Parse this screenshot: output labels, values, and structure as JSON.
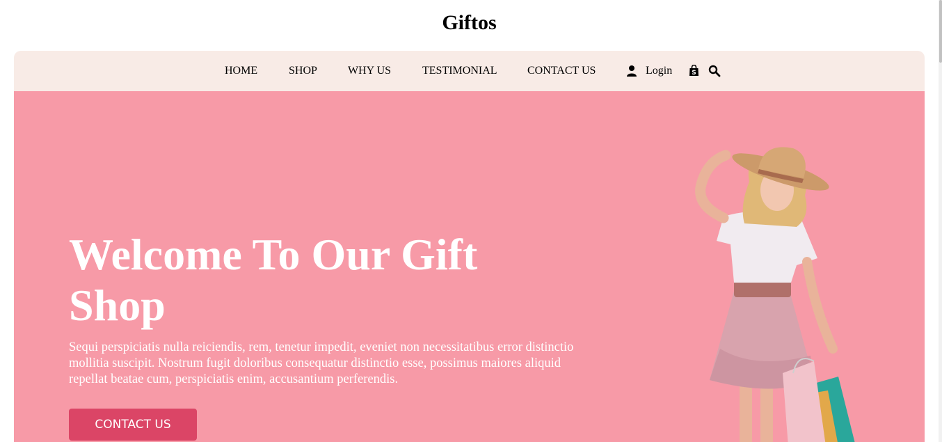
{
  "brand": {
    "name": "Giftos"
  },
  "nav": {
    "items": [
      {
        "label": "HOME"
      },
      {
        "label": "SHOP"
      },
      {
        "label": "WHY US"
      },
      {
        "label": "TESTIMONIAL"
      },
      {
        "label": "CONTACT US"
      }
    ],
    "login_label": "Login",
    "icons": [
      "user-icon",
      "shopping-bag-icon",
      "search-icon"
    ]
  },
  "hero": {
    "title": "Welcome To Our Gift Shop",
    "text": "Sequi perspiciatis nulla reiciendis, rem, tenetur impedit, eveniet non necessitatibus error distinctio mollitia suscipit. Nostrum fugit doloribus consequatur distinctio esse, possimus maiores aliquid repellat beatae cum, perspiciatis enim, accusantium perferendis.",
    "button_label": "CONTACT US"
  },
  "colors": {
    "nav_bg": "#f8ebe6",
    "hero_bg": "#f79aa7",
    "button_bg": "#db4566"
  }
}
